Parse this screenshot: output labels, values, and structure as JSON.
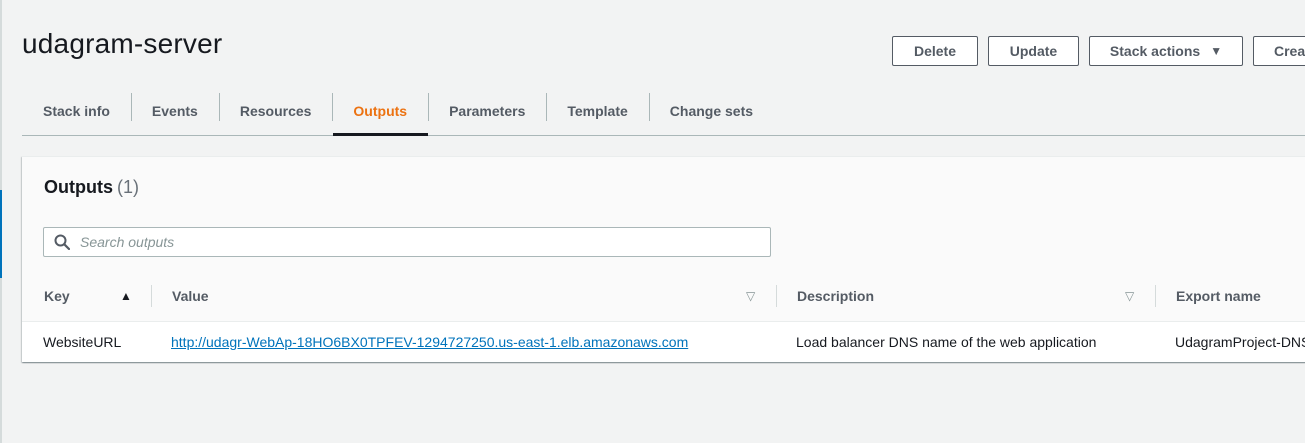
{
  "page": {
    "title": "udagram-server"
  },
  "actions": {
    "delete_label": "Delete",
    "update_label": "Update",
    "stack_actions_label": "Stack actions",
    "create_label": "Creat"
  },
  "tabs": [
    {
      "label": "Stack info"
    },
    {
      "label": "Events"
    },
    {
      "label": "Resources"
    },
    {
      "label": "Outputs",
      "active": true
    },
    {
      "label": "Parameters"
    },
    {
      "label": "Template"
    },
    {
      "label": "Change sets"
    }
  ],
  "outputs": {
    "title": "Outputs",
    "count": "(1)",
    "search_placeholder": "Search outputs",
    "columns": [
      {
        "label": "Key",
        "sort": "ascending"
      },
      {
        "label": "Value",
        "sort": "sortable"
      },
      {
        "label": "Description",
        "sort": "sortable"
      },
      {
        "label": "Export name"
      }
    ],
    "rows": [
      {
        "key": "WebsiteURL",
        "value": "http://udagr-WebAp-18HO6BX0TPFEV-1294727250.us-east-1.elb.amazonaws.com",
        "description": "Load balancer DNS name of the web application",
        "export_name": "UdagramProject-DNS"
      }
    ]
  },
  "colors": {
    "accent": "#ec7211",
    "link": "#0073bb",
    "text": "#16191f",
    "muted": "#545b64"
  }
}
